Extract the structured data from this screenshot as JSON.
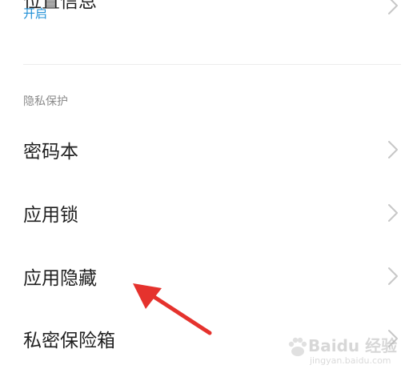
{
  "settings": {
    "location": {
      "title": "位置信息",
      "status": "开启"
    },
    "section_header": "隐私保护",
    "items": [
      {
        "title": "密码本"
      },
      {
        "title": "应用锁"
      },
      {
        "title": "应用隐藏"
      },
      {
        "title": "私密保险箱"
      }
    ]
  },
  "watermark": {
    "text": "Baidu 经验",
    "sub": "jingyan.baidu.com"
  },
  "colors": {
    "accent": "#1e8fd6",
    "annotation_arrow": "#e5322d",
    "text_primary": "#1f1f1f",
    "text_secondary": "#8a8a8a",
    "chevron": "#c7c7c7"
  },
  "icons": {
    "chevron": "chevron-right-icon",
    "annotation": "red-arrow-icon"
  }
}
